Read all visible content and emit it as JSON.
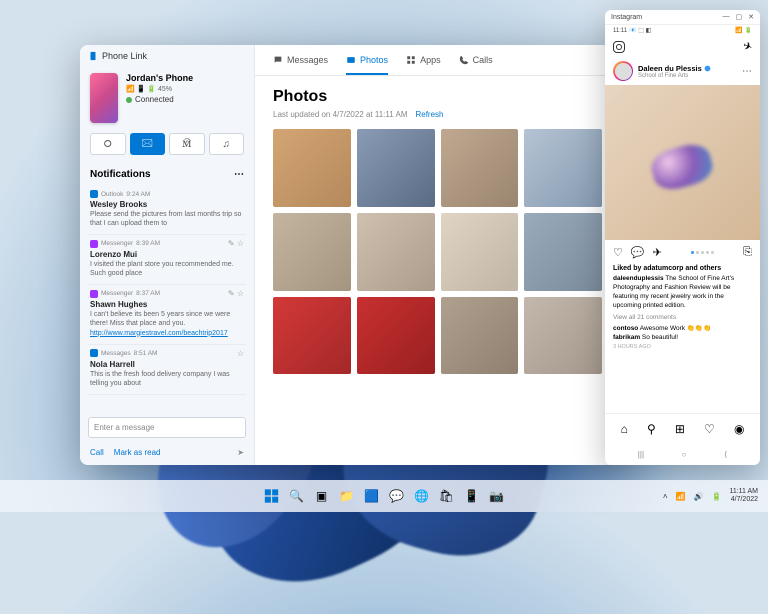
{
  "phonelink": {
    "title": "Phone Link",
    "device_name": "Jordan's Phone",
    "signal_battery": "📶 📱 🔋 45%",
    "connected": "Connected",
    "btns": [
      "⭘",
      "🖂",
      "🕅",
      "♫"
    ],
    "notif_header": "Notifications",
    "notifications": [
      {
        "app": "Outlook",
        "time": "9:24 AM",
        "color": "#0078d4",
        "name": "Wesley Brooks",
        "body": "Please send the pictures from last months trip so that I can upload them to"
      },
      {
        "app": "Messenger",
        "time": "8:39 AM",
        "color": "#a033ff",
        "icons": "✎ ☆",
        "name": "Lorenzo Mui",
        "body": "I visited the plant store you recommended me. Such good place"
      },
      {
        "app": "Messenger",
        "time": "8:37 AM",
        "color": "#a033ff",
        "icons": "✎ ☆",
        "name": "Shawn Hughes",
        "body": "I can't believe its been 5 years since we were there! Miss that place and you.",
        "link": "http://www.margiestravel.com/beachtrip2017"
      },
      {
        "app": "Messages",
        "time": "8:51 AM",
        "color": "#0078d4",
        "icons": "☆",
        "name": "Nola Harrell",
        "body": "This is the fresh food delivery company I was telling you about"
      }
    ],
    "input_placeholder": "Enter a message",
    "foot_call": "Call",
    "foot_mark": "Mark as read",
    "tabs": [
      {
        "icon": "msg",
        "label": "Messages"
      },
      {
        "icon": "photo",
        "label": "Photos"
      },
      {
        "icon": "apps",
        "label": "Apps"
      },
      {
        "icon": "call",
        "label": "Calls"
      }
    ],
    "content_title": "Photos",
    "updated": "Last updated on 4/7/2022 at 11:11 AM",
    "refresh": "Refresh"
  },
  "instagram": {
    "title": "Instagram",
    "status_time": "11:11",
    "username": "Daleen du Plessis",
    "subtitle": "School of Fine Arts",
    "likes_by": "Liked by adatumcorp and others",
    "caption_user": "daleenduplessis",
    "caption": "The School of Fine Art's Photography and Fashion Review will be featuring my recent jewelry work in the upcoming printed edition.",
    "view_comments": "View all 21 comments",
    "c1_user": "contoso",
    "c1": "Awesome Work 👏👏👏",
    "c2_user": "fabrikam",
    "c2": "So beautiful!",
    "time": "3 hours ago"
  },
  "taskbar": {
    "time": "11:11 AM",
    "date": "4/7/2022"
  }
}
